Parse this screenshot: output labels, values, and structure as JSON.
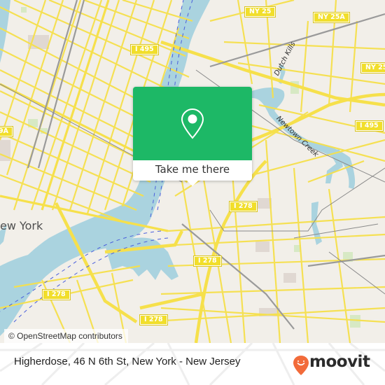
{
  "map": {
    "attribution": "© OpenStreetMap contributors",
    "place_labels": [
      {
        "id": "new-york",
        "text": "New York"
      }
    ],
    "water_labels": [
      {
        "id": "dutch-kills",
        "text": "Dutch Kills"
      },
      {
        "id": "newtown-creek",
        "text": "Newtown Creek"
      }
    ],
    "route_shields": [
      {
        "id": "ny25-top",
        "text": "NY 25"
      },
      {
        "id": "ny25a",
        "text": "NY 25A"
      },
      {
        "id": "ny25-right",
        "text": "NY 25"
      },
      {
        "id": "i495-left",
        "text": "I 495"
      },
      {
        "id": "i495-right",
        "text": "I 495"
      },
      {
        "id": "i278-a",
        "text": "I 278"
      },
      {
        "id": "i278-b",
        "text": "I 278"
      },
      {
        "id": "i278-c",
        "text": "I 278"
      },
      {
        "id": "i278-d",
        "text": "I 278"
      },
      {
        "id": "9a-partial",
        "text": "9A"
      }
    ],
    "colors": {
      "land": "#f2efe9",
      "water": "#aad3df",
      "road": "#f6e04b",
      "rail": "#999999",
      "ferry": "#4b5fdc"
    }
  },
  "popup": {
    "icon": "map-pin-icon",
    "button_label": "Take me there",
    "accent_color": "#1db866"
  },
  "footer": {
    "location_text": "Higherdose, 46 N 6th St, New York - New Jersey",
    "brand": {
      "name": "moovit",
      "icon": "moovit-smile-pin-icon",
      "color": "#f26b3a"
    }
  }
}
